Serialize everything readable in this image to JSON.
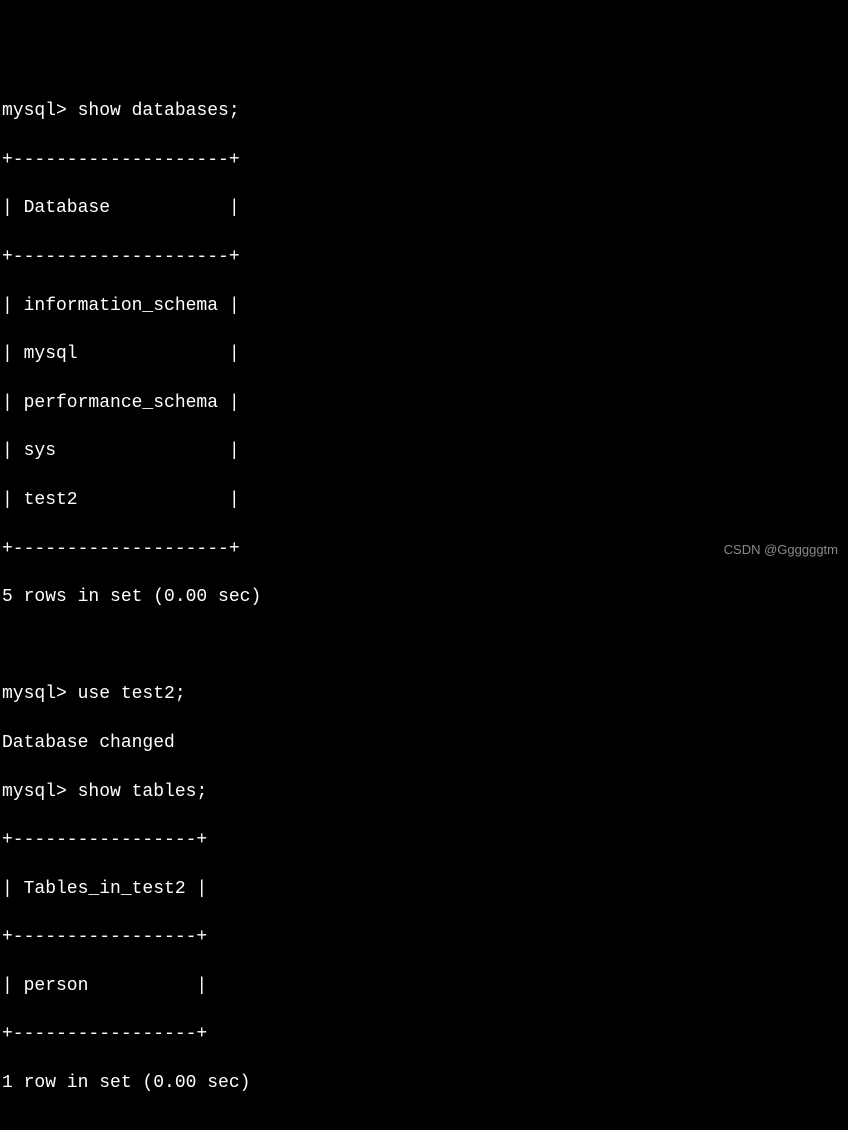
{
  "prompt": "mysql>",
  "cmd_show_db": "show databases;",
  "db_table": {
    "sep": "+--------------------+",
    "header_row": "| Database           |",
    "rows": [
      "| information_schema |",
      "| mysql              |",
      "| performance_schema |",
      "| sys                |",
      "| test2              |"
    ]
  },
  "db_summary": "5 rows in set (0.00 sec)",
  "cmd_use": "use test2;",
  "use_result": "Database changed",
  "cmd_show_tables": "show tables;",
  "tbl_table": {
    "sep": "+-----------------+",
    "header_row": "| Tables_in_test2 |",
    "rows": [
      "| person          |"
    ]
  },
  "tbl_summary": "1 row in set (0.00 sec)",
  "watermark": "CSDN @Ggggggtm"
}
